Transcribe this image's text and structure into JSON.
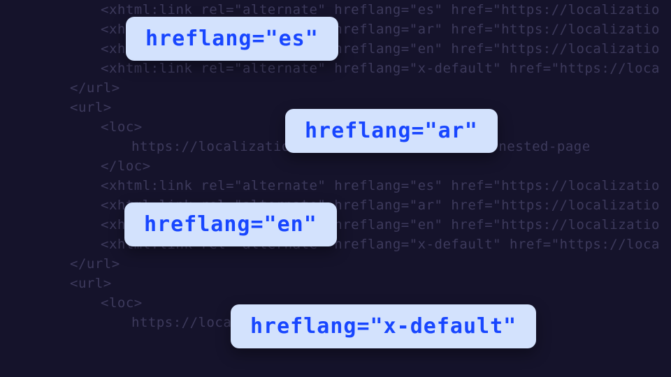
{
  "pills": {
    "es": "hreflang=\"es\"",
    "ar": "hreflang=\"ar\"",
    "en": "hreflang=\"en\"",
    "xdefault": "hreflang=\"x-default\""
  },
  "code_lines": [
    {
      "indent": "i2",
      "text": "<xhtml:link rel=\"alternate\" hreflang=\"es\" href=\"https://localizatio"
    },
    {
      "indent": "i2",
      "text": "<xhtml:link rel=\"alternate\" hreflang=\"ar\" href=\"https://localizatio"
    },
    {
      "indent": "i2",
      "text": "<xhtml:link rel=\"alternate\" hreflang=\"en\" href=\"https://localizatio"
    },
    {
      "indent": "i2",
      "text": "<xhtml:link rel=\"alternate\" hreflang=\"x-default\" href=\"https://loca"
    },
    {
      "indent": "i1",
      "text": "</url>"
    },
    {
      "indent": "i1",
      "text": "<url>"
    },
    {
      "indent": "i2",
      "text": "<loc>"
    },
    {
      "indent": "i3",
      "text": "https://localization-demo.webflow.io/folder/nested-page"
    },
    {
      "indent": "i2",
      "text": "</loc>"
    },
    {
      "indent": "i2",
      "text": "<xhtml:link rel=\"alternate\" hreflang=\"es\" href=\"https://localizatio"
    },
    {
      "indent": "i2",
      "text": "<xhtml:link rel=\"alternate\" hreflang=\"ar\" href=\"https://localizatio"
    },
    {
      "indent": "i2",
      "text": "<xhtml:link rel=\"alternate\" hreflang=\"en\" href=\"https://localizatio"
    },
    {
      "indent": "i2",
      "text": "<xhtml:link rel=\"alternate\" hreflang=\"x-default\" href=\"https://loca"
    },
    {
      "indent": "i1",
      "text": "</url>"
    },
    {
      "indent": "i1",
      "text": "<url>"
    },
    {
      "indent": "i2",
      "text": "<loc>"
    },
    {
      "indent": "i3",
      "text": "https://localization-demo.webflow.io/static-page"
    }
  ]
}
